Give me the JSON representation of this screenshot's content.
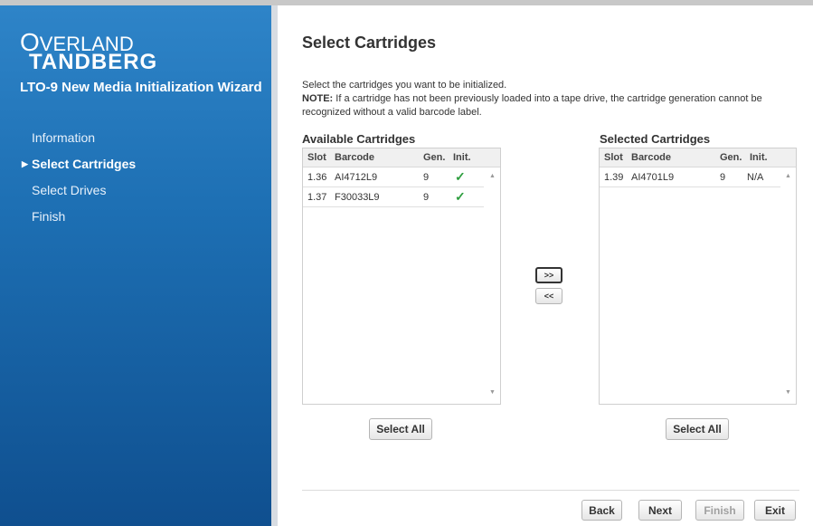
{
  "brand": {
    "logo_line1": "VERLAND",
    "logo_q": "O",
    "logo_line2": "TANDBERG"
  },
  "wizard_title": "LTO-9 New Media Initialization Wizard",
  "nav": {
    "items": [
      {
        "label": "Information"
      },
      {
        "label": "Select Cartridges",
        "active": true
      },
      {
        "label": "Select Drives"
      },
      {
        "label": "Finish"
      }
    ]
  },
  "page": {
    "title": "Select Cartridges",
    "instruction": "Select the cartridges you want to be initialized.",
    "note_label": "NOTE:",
    "note_text": " If a cartridge has not been previously loaded into a tape drive, the cartridge generation cannot be recognized without a valid barcode label."
  },
  "available": {
    "title": "Available Cartridges",
    "columns": [
      "Slot",
      "Barcode",
      "Gen.",
      "Init."
    ],
    "rows": [
      {
        "slot": "1.36",
        "barcode": "AI4712L9",
        "gen": "9",
        "init": "✓"
      },
      {
        "slot": "1.37",
        "barcode": "F30033L9",
        "gen": "9",
        "init": "✓"
      }
    ],
    "select_all": "Select All"
  },
  "selected": {
    "title": "Selected Cartridges",
    "columns": [
      "Slot",
      "Barcode",
      "Gen.",
      "Init."
    ],
    "rows": [
      {
        "slot": "1.39",
        "barcode": "AI4701L9",
        "gen": "9",
        "init": "N/A"
      }
    ],
    "select_all": "Select All"
  },
  "transfer": {
    "add": ">>",
    "remove": "<<"
  },
  "footer": {
    "back": "Back",
    "next": "Next",
    "finish": "Finish",
    "exit": "Exit"
  },
  "icons": {
    "nav_active": "triangle-right-icon",
    "init_ok": "checkmark-icon",
    "scroll_up": "scroll-up-arrow-icon",
    "scroll_down": "scroll-down-arrow-icon"
  },
  "colors": {
    "sidebar_top": "#2e84c8",
    "sidebar_bottom": "#0f4f8f",
    "check": "#2e9e3f"
  }
}
